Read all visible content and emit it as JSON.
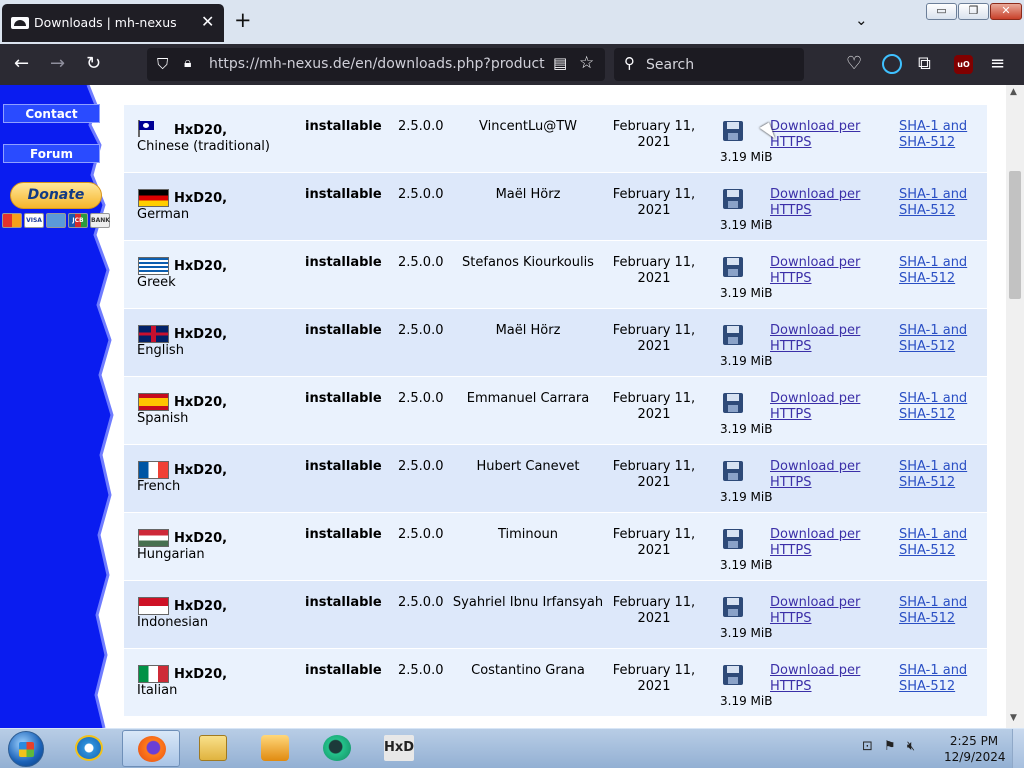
{
  "browser": {
    "tab_title": "Downloads | mh-nexus",
    "close_tab": "✕",
    "new_tab": "+",
    "tab_list": "⌄",
    "url": "https://mh-nexus.de/en/downloads.php?product=HxD",
    "search_placeholder": "Search",
    "window_controls": {
      "minimize": "▭",
      "maximize": "❐",
      "close": "✕"
    }
  },
  "sidebar": {
    "nav": [
      {
        "label": "Contact"
      },
      {
        "label": "Forum"
      }
    ],
    "donate_label": "Donate",
    "cards": [
      "VISA",
      "JCB",
      "BANK"
    ]
  },
  "downloads": {
    "rows": [
      {
        "product": "HxD20,",
        "language": "Chinese (traditional)",
        "type": "installable",
        "version": "2.5.0.0",
        "translator": "VincentLu@TW",
        "date_line1": "February 11,",
        "date_line2": "2021",
        "size": "3.19 MiB",
        "download_line1": "Download per",
        "download_line2": "HTTPS",
        "hash_line1": "SHA-1 and",
        "hash_line2": "SHA-512",
        "flag": "taiwan"
      },
      {
        "product": "HxD20,",
        "language": "German",
        "type": "installable",
        "version": "2.5.0.0",
        "translator": "Maël Hörz",
        "date_line1": "February 11,",
        "date_line2": "2021",
        "size": "3.19 MiB",
        "download_line1": "Download per",
        "download_line2": "HTTPS",
        "hash_line1": "SHA-1 and",
        "hash_line2": "SHA-512",
        "flag": "germany"
      },
      {
        "product": "HxD20,",
        "language": "Greek",
        "type": "installable",
        "version": "2.5.0.0",
        "translator": "Stefanos Kiourkoulis",
        "date_line1": "February 11,",
        "date_line2": "2021",
        "size": "3.19 MiB",
        "download_line1": "Download per",
        "download_line2": "HTTPS",
        "hash_line1": "SHA-1 and",
        "hash_line2": "SHA-512",
        "flag": "greece"
      },
      {
        "product": "HxD20,",
        "language": "English",
        "type": "installable",
        "version": "2.5.0.0",
        "translator": "Maël Hörz",
        "date_line1": "February 11,",
        "date_line2": "2021",
        "size": "3.19 MiB",
        "download_line1": "Download per",
        "download_line2": "HTTPS",
        "hash_line1": "SHA-1 and",
        "hash_line2": "SHA-512",
        "flag": "uk"
      },
      {
        "product": "HxD20,",
        "language": "Spanish",
        "type": "installable",
        "version": "2.5.0.0",
        "translator": "Emmanuel Carrara",
        "date_line1": "February 11,",
        "date_line2": "2021",
        "size": "3.19 MiB",
        "download_line1": "Download per",
        "download_line2": "HTTPS",
        "hash_line1": "SHA-1 and",
        "hash_line2": "SHA-512",
        "flag": "spain"
      },
      {
        "product": "HxD20,",
        "language": "French",
        "type": "installable",
        "version": "2.5.0.0",
        "translator": "Hubert Canevet",
        "date_line1": "February 11,",
        "date_line2": "2021",
        "size": "3.19 MiB",
        "download_line1": "Download per",
        "download_line2": "HTTPS",
        "hash_line1": "SHA-1 and",
        "hash_line2": "SHA-512",
        "flag": "france"
      },
      {
        "product": "HxD20,",
        "language": "Hungarian",
        "type": "installable",
        "version": "2.5.0.0",
        "translator": "Timinoun",
        "date_line1": "February 11,",
        "date_line2": "2021",
        "size": "3.19 MiB",
        "download_line1": "Download per",
        "download_line2": "HTTPS",
        "hash_line1": "SHA-1 and",
        "hash_line2": "SHA-512",
        "flag": "hungary"
      },
      {
        "product": "HxD20,",
        "language": "Indonesian",
        "type": "installable",
        "version": "2.5.0.0",
        "translator": "Syahriel Ibnu Irfansyah",
        "date_line1": "February 11,",
        "date_line2": "2021",
        "size": "3.19 MiB",
        "download_line1": "Download per",
        "download_line2": "HTTPS",
        "hash_line1": "SHA-1 and",
        "hash_line2": "SHA-512",
        "flag": "indonesia"
      },
      {
        "product": "HxD20,",
        "language": "Italian",
        "type": "installable",
        "version": "2.5.0.0",
        "translator": "Costantino Grana",
        "date_line1": "February 11,",
        "date_line2": "2021",
        "size": "3.19 MiB",
        "download_line1": "Download per",
        "download_line2": "HTTPS",
        "hash_line1": "SHA-1 and",
        "hash_line2": "SHA-512",
        "flag": "italy"
      }
    ]
  },
  "taskbar": {
    "hxd_label": "HxD",
    "time": "2:25 PM",
    "date": "12/9/2024"
  },
  "colors": {
    "sidebar_blue": "#0a1cf0",
    "row_even": "#dde8fa",
    "row_odd": "#eaf2fd",
    "link_visited": "#3b2fa8",
    "link": "#2a4fc4"
  }
}
